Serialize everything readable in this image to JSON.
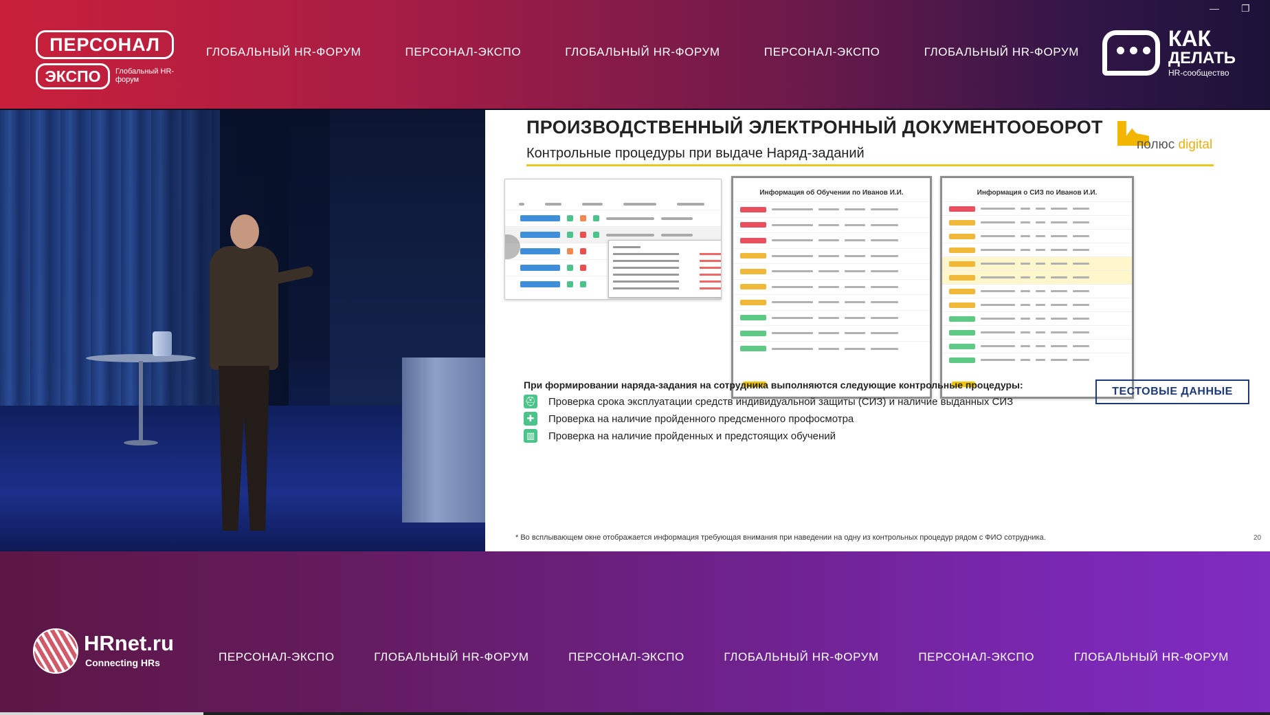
{
  "header": {
    "logo_main": "ПЕРСОНАЛ",
    "logo_sub_box": "ЭКСПО",
    "logo_sub_text": "Глобальный HR-форум",
    "nav": [
      "ГЛОБАЛЬНЫЙ HR-ФОРУМ",
      "ПЕРСОНАЛ-ЭКСПО",
      "ГЛОБАЛЬНЫЙ HR-ФОРУМ",
      "ПЕРСОНАЛ-ЭКСПО",
      "ГЛОБАЛЬНЫЙ HR-ФОРУМ"
    ],
    "partner_title1": "КАК",
    "partner_title2": "ДЕЛАТЬ",
    "partner_sub": "HR-сообщество",
    "window_minimize": "—",
    "window_restore": "❐"
  },
  "slide": {
    "title": "ПРОИЗВОДСТВЕННЫЙ ЭЛЕКТРОННЫЙ ДОКУМЕНТООБОРОТ",
    "subtitle": "Контрольные процедуры при выдаче Наряд-заданий",
    "brand_left": "полюс",
    "brand_right": " digital",
    "panel_training_title": "Информация об Обучении по Иванов И.И.",
    "panel_ppe_title": "Информация о СИЗ по Иванов И.И.",
    "procedures_title": "При формировании наряда-задания на сотрудника выполняются следующие контрольные процедуры:",
    "checks": [
      "Проверка срока эксплуатации средств индивидуальной защиты (СИЗ) и наличие выданных СИЗ",
      "Проверка на наличие пройденного предсменного профосмотра",
      "Проверка на наличие пройденных и предстоящих обучений"
    ],
    "test_button": "ТЕСТОВЫЕ ДАННЫЕ",
    "footnote": "* Во всплывающем окне отображается информация требующая внимания при наведении на одну из контрольных процедур рядом с ФИО сотрудника.",
    "page_number": "20"
  },
  "footer": {
    "brand": "HRnet.ru",
    "brand_sub": "Connecting HRs",
    "nav": [
      "ПЕРСОНАЛ-ЭКСПО",
      "ГЛОБАЛЬНЫЙ HR-ФОРУМ",
      "ПЕРСОНАЛ-ЭКСПО",
      "ГЛОБАЛЬНЫЙ HR-ФОРУМ",
      "ПЕРСОНАЛ-ЭКСПО",
      "ГЛОБАЛЬНЫЙ HR-ФОРУМ"
    ]
  },
  "colors": {
    "header_red": "#c8203a",
    "footer_purple": "#7a28b4",
    "accent_yellow": "#e8c81a",
    "button_blue": "#1c3a7a"
  },
  "icons": {
    "check_ppe": "helmet-icon",
    "check_medical": "plus-icon",
    "check_training": "book-icon"
  },
  "video_progress": 0.16
}
